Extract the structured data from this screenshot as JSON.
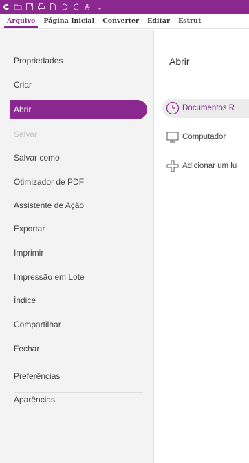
{
  "quick_access": {
    "icons": [
      "app-logo-icon",
      "open-folder-icon",
      "save-icon",
      "print-icon",
      "new-document-icon",
      "undo-icon",
      "redo-icon",
      "hand-tool-icon",
      "customize-dropdown-icon"
    ]
  },
  "ribbon": {
    "tabs": [
      {
        "label": "Arquivo",
        "active": true
      },
      {
        "label": "Página Inicial"
      },
      {
        "label": "Converter"
      },
      {
        "label": "Editar"
      },
      {
        "label": "Estrut"
      }
    ]
  },
  "sidebar": {
    "items": [
      {
        "label": "Propriedades"
      },
      {
        "label": "Criar"
      },
      {
        "label": "Abrir",
        "active": true
      },
      {
        "label": "Salvar",
        "disabled": true
      },
      {
        "label": "Salvar como"
      },
      {
        "label": "Otimizador de PDF"
      },
      {
        "label": "Assistente de Ação"
      },
      {
        "label": "Exportar"
      },
      {
        "label": "Imprimir"
      },
      {
        "label": "Impressão em Lote"
      },
      {
        "label": "Índice"
      },
      {
        "label": "Compartilhar"
      },
      {
        "label": "Fechar"
      },
      {
        "label": "Preferências"
      },
      {
        "label": "Aparências"
      }
    ]
  },
  "main": {
    "title": "Abrir",
    "options": [
      {
        "label": "Documentos R",
        "icon": "clock-icon",
        "selected": true
      },
      {
        "label": "Computador",
        "icon": "computer-icon"
      },
      {
        "label": "Adicionar um lu",
        "icon": "add-place-icon"
      }
    ]
  },
  "colors": {
    "accent": "#8a288f",
    "sidebar_bg": "#f3f3f3",
    "disabled_text": "#c2c2c2"
  }
}
